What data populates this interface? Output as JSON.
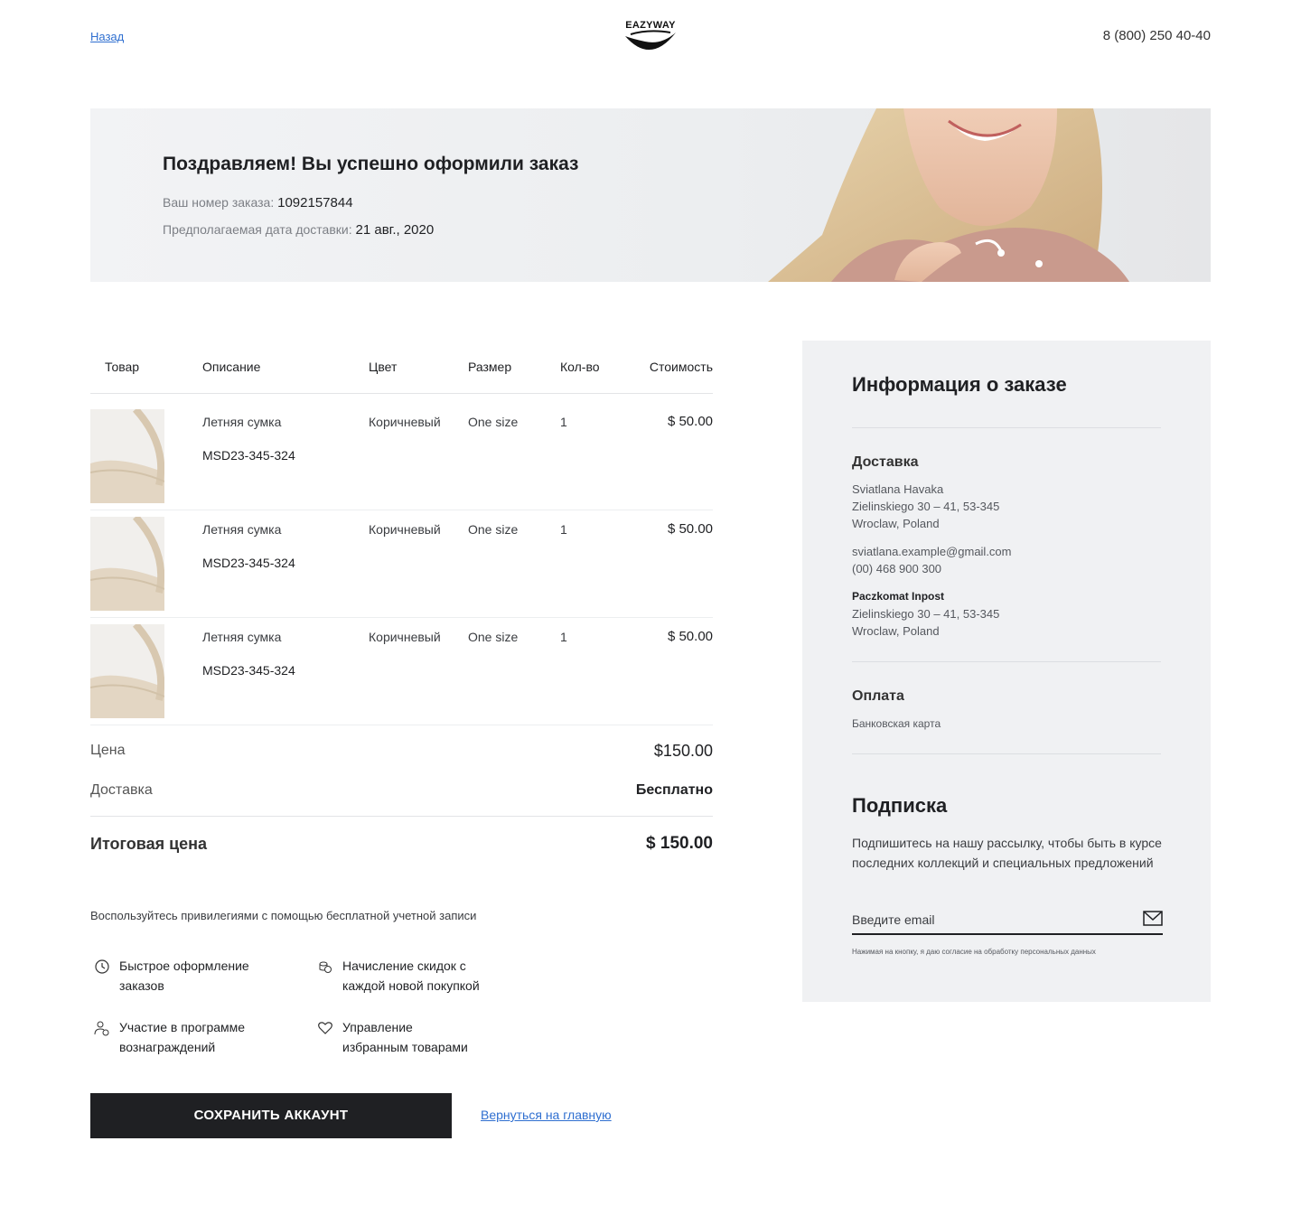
{
  "header": {
    "back_label": "Назад",
    "logo_text": "EAZYWAY",
    "phone": "8 (800) 250 40-40"
  },
  "hero": {
    "title": "Поздравляем! Вы успешно оформили заказ",
    "order_label": "Ваш номер заказа:",
    "order_number": "1092157844",
    "delivery_label": "Предполагаемая дата доставки:",
    "delivery_date": "21 авг., 2020"
  },
  "table": {
    "headers": [
      "Товар",
      "Описание",
      "Цвет",
      "Размер",
      "Кол-во",
      "Стоимость"
    ],
    "rows": [
      {
        "name": "Летняя сумка",
        "sku": "MSD23-345-324",
        "color": "Коричневый",
        "size": "One size",
        "qty": "1",
        "price": "$ 50.00"
      },
      {
        "name": "Летняя сумка",
        "sku": "MSD23-345-324",
        "color": "Коричневый",
        "size": "One size",
        "qty": "1",
        "price": "$ 50.00"
      },
      {
        "name": "Летняя сумка",
        "sku": "MSD23-345-324",
        "color": "Коричневый",
        "size": "One size",
        "qty": "1",
        "price": "$ 50.00"
      }
    ]
  },
  "summary": {
    "price_label": "Цена",
    "price_value": "$150.00",
    "delivery_label": "Доставка",
    "delivery_value": "Бесплатно",
    "total_label": "Итоговая цена",
    "total_value": "$ 150.00"
  },
  "account": {
    "promo": "Воспользуйтесь привилегиями с помощью бесплатной учетной записи",
    "benefits": [
      {
        "line1": "Быстрое оформление",
        "line2": "заказов",
        "icon": "clock-icon"
      },
      {
        "line1": "Начисление скидок с",
        "line2": "каждой новой покупкой",
        "icon": "coins-icon"
      },
      {
        "line1": "Участие в программе",
        "line2": "вознаграждений",
        "icon": "user-reward-icon"
      },
      {
        "line1": "Управление",
        "line2": "избранным товарами",
        "icon": "heart-icon"
      }
    ],
    "save_button": "СОХРАНИТЬ АККАУНТ",
    "home_link": "Вернуться на главную"
  },
  "sidebar": {
    "title": "Информация о заказе",
    "delivery_heading": "Доставка",
    "recipient_name": "Sviatlana Havaka",
    "address_line1": "Zielinskiego 30 – 41, 53-345",
    "address_line2": "Wroclaw, Poland",
    "email": "sviatlana.example@gmail.com",
    "phone": "(00) 468 900 300",
    "pickup_name": "Paczkomat Inpost",
    "pickup_line1": "Zielinskiego 30 – 41, 53-345",
    "pickup_line2": "Wroclaw, Poland",
    "payment_heading": "Оплата",
    "payment_method": "Банковская карта",
    "subscribe_heading": "Подписка",
    "subscribe_line1": "Подпишитесь на нашу рассылку, чтобы быть в курсе",
    "subscribe_line2": "последних коллекций и специальных предложений",
    "email_placeholder": "Введите email",
    "consent": "Нажимая на кнопку, я даю согласие на обработку персональных данных"
  },
  "colors": {
    "accent_link": "#2f6fd0",
    "dark_button": "#1f2023",
    "panel_bg": "#f0f1f3"
  }
}
